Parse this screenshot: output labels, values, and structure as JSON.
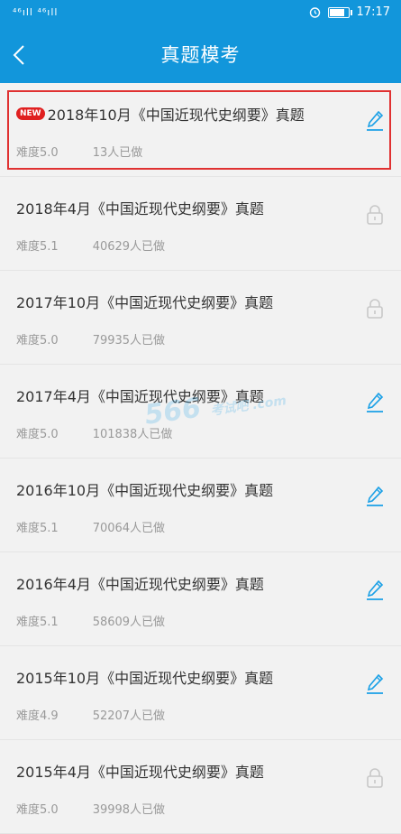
{
  "status_bar": {
    "signal_text": "⁴⁶ıll ⁴⁶ıll",
    "time": "17:17",
    "battery_level": 0.8
  },
  "nav": {
    "title": "真题模考"
  },
  "items": [
    {
      "title": "2018年10月《中国近现代史纲要》真题",
      "difficulty": "难度5.0",
      "count": "13人已做",
      "is_new": true,
      "new_label": "NEW",
      "icon": "edit-icon",
      "highlighted": true
    },
    {
      "title": "2018年4月《中国近现代史纲要》真题",
      "difficulty": "难度5.1",
      "count": "40629人已做",
      "is_new": false,
      "icon": "lock-icon"
    },
    {
      "title": "2017年10月《中国近现代史纲要》真题",
      "difficulty": "难度5.0",
      "count": "79935人已做",
      "is_new": false,
      "icon": "lock-icon"
    },
    {
      "title": "2017年4月《中国近现代史纲要》真题",
      "difficulty": "难度5.0",
      "count": "101838人已做",
      "is_new": false,
      "icon": "edit-icon"
    },
    {
      "title": "2016年10月《中国近现代史纲要》真题",
      "difficulty": "难度5.1",
      "count": "70064人已做",
      "is_new": false,
      "icon": "edit-icon"
    },
    {
      "title": "2016年4月《中国近现代史纲要》真题",
      "difficulty": "难度5.1",
      "count": "58609人已做",
      "is_new": false,
      "icon": "edit-icon"
    },
    {
      "title": "2015年10月《中国近现代史纲要》真题",
      "difficulty": "难度4.9",
      "count": "52207人已做",
      "is_new": false,
      "icon": "edit-icon"
    },
    {
      "title": "2015年4月《中国近现代史纲要》真题",
      "difficulty": "难度5.0",
      "count": "39998人已做",
      "is_new": false,
      "icon": "lock-icon"
    }
  ],
  "watermark": {
    "text": "566",
    "sub": "考试吧 .com"
  },
  "colors": {
    "primary": "#1296db",
    "badge": "#e02020",
    "highlight": "#e03131",
    "edit_icon": "#1aa0e6",
    "lock_icon": "#c8c8c8"
  }
}
